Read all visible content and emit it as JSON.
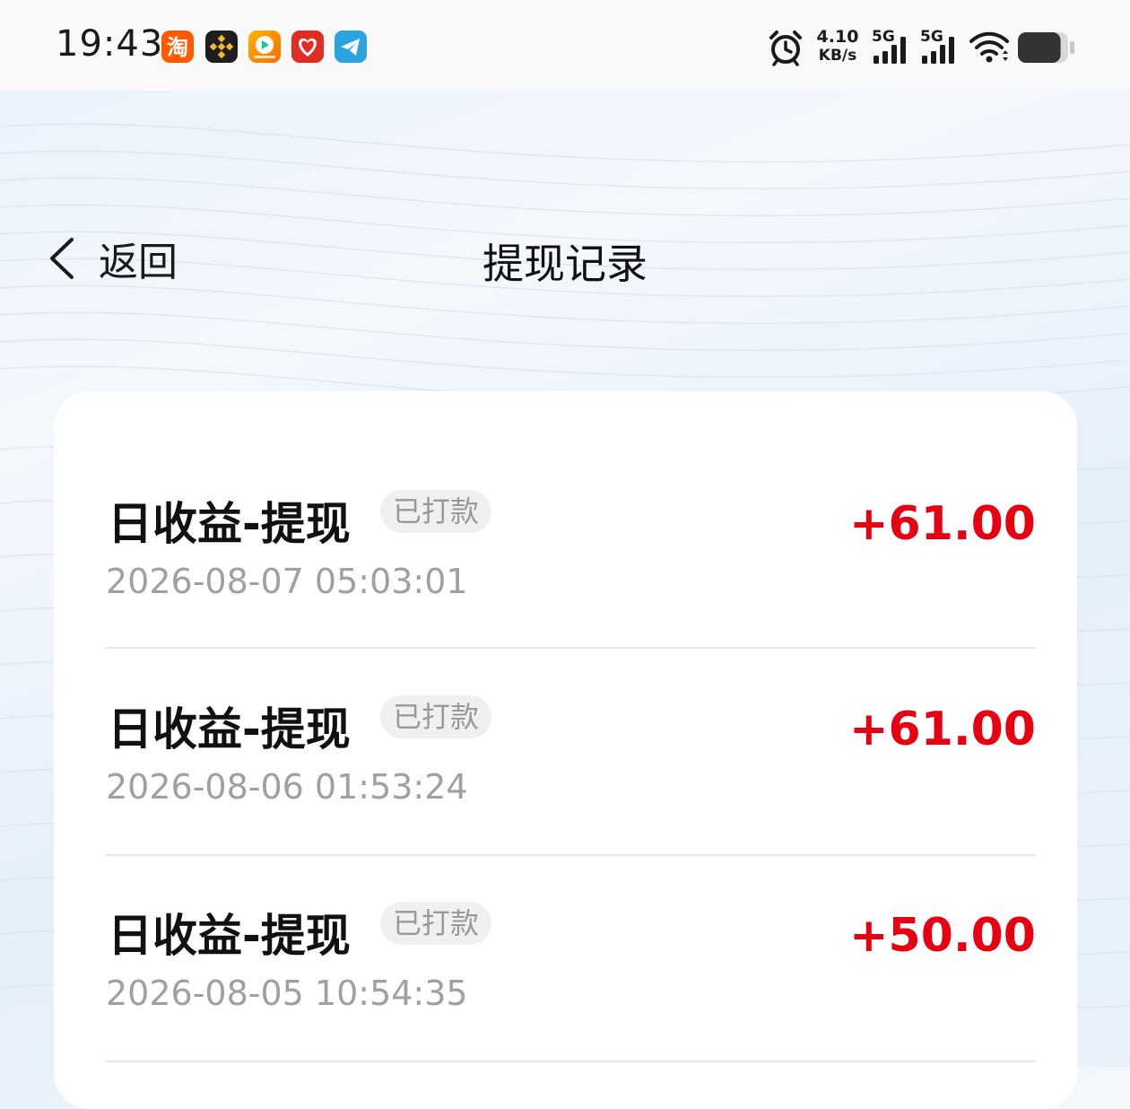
{
  "status_bar": {
    "time": "19:43",
    "apps": [
      "taobao-icon",
      "binance-icon",
      "video-app-icon",
      "pinduoduo-icon",
      "telegram-icon"
    ],
    "net_speed_value": "4.10",
    "net_speed_unit": "KB/s",
    "sim1_label": "5G",
    "sim2_label": "5G",
    "battery_level": 0.85
  },
  "header": {
    "back_label": "返回",
    "title": "提现记录"
  },
  "records": [
    {
      "title": "日收益-提现",
      "status": "已打款",
      "time": "2026-08-07 05:03:01",
      "amount": "+61.00"
    },
    {
      "title": "日收益-提现",
      "status": "已打款",
      "time": "2026-08-06 01:53:24",
      "amount": "+61.00"
    },
    {
      "title": "日收益-提现",
      "status": "已打款",
      "time": "2026-08-05 10:54:35",
      "amount": "+50.00"
    }
  ],
  "colors": {
    "amount": "#e60012",
    "badge_bg": "#f0f0f0",
    "badge_text": "#999999",
    "time_text": "#a0a0a0"
  }
}
